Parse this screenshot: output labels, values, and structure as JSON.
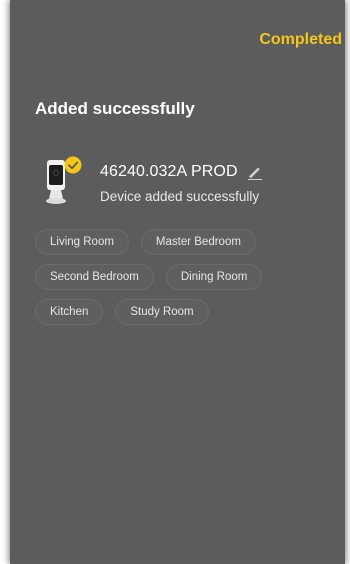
{
  "header": {
    "action_label": "Completed"
  },
  "title": "Added successfully",
  "device": {
    "name": "46240.032A PROD",
    "status": "Device added successfully",
    "thumbnail_icon": "camera-icon",
    "badge_icon": "check-badge-icon",
    "edit_icon": "pencil-icon"
  },
  "rooms": [
    [
      "Living Room",
      "Master Bedroom"
    ],
    [
      "Second Bedroom",
      "Dining Room"
    ],
    [
      "Kitchen",
      "Study Room"
    ]
  ],
  "colors": {
    "background": "#5c5c5c",
    "accent": "#f5c518",
    "text": "#ffffff",
    "chip_border": "#6b6b6b"
  }
}
